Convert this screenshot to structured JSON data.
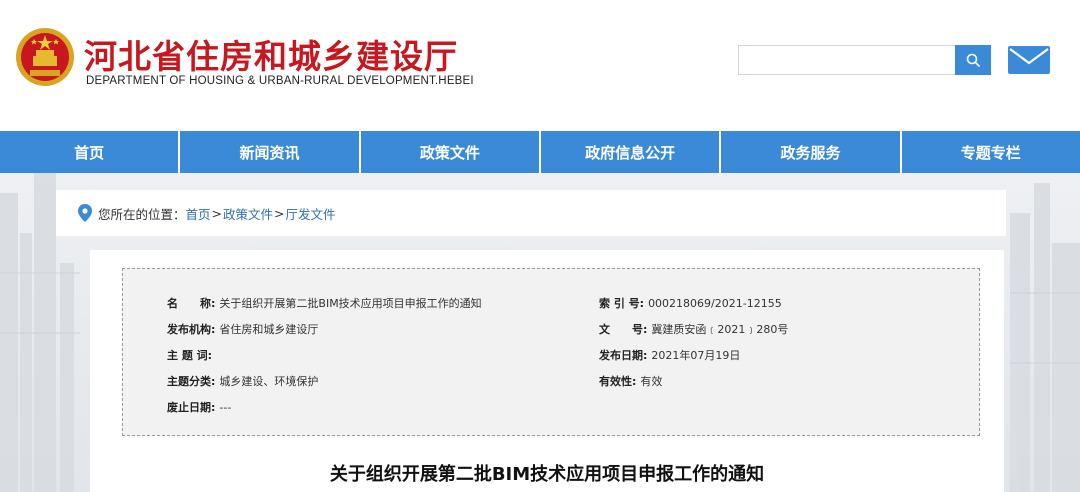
{
  "header": {
    "title": "河北省住房和城乡建设厅",
    "subtitle": "DEPARTMENT OF HOUSING & URBAN-RURAL DEVELOPMENT.HEBEI",
    "search": {
      "value": "",
      "placeholder": ""
    },
    "search_icon": "search-icon",
    "mail_icon": "mail-icon",
    "emblem_icon": "national-emblem-icon"
  },
  "nav": {
    "items": [
      {
        "label": "首页"
      },
      {
        "label": "新闻资讯"
      },
      {
        "label": "政策文件"
      },
      {
        "label": "政府信息公开"
      },
      {
        "label": "政务服务"
      },
      {
        "label": "专题专栏"
      }
    ]
  },
  "breadcrumb": {
    "label": "您所在的位置：",
    "items": [
      "首页",
      "政策文件",
      "厅发文件"
    ],
    "separator": ">"
  },
  "meta": {
    "name_key": "名　　称:",
    "name_val": "关于组织开展第二批BIM技术应用项目申报工作的通知",
    "issuer_key": "发布机构:",
    "issuer_val": "省住房和城乡建设厅",
    "keywords_key": "主 题 词:",
    "keywords_val": "",
    "category_key": "主题分类:",
    "category_val": "城乡建设、环境保护",
    "abolish_key": "废止日期:",
    "abolish_val": "---",
    "index_key": "索 引 号:",
    "index_val": "000218069/2021-12155",
    "docno_key": "文　　号:",
    "docno_val": "冀建质安函﹝2021﹞280号",
    "date_key": "发布日期:",
    "date_val": "2021年07月19日",
    "validity_key": "有效性:",
    "validity_val": "有效"
  },
  "document": {
    "title": "关于组织开展第二批BIM技术应用项目申报工作的通知"
  },
  "colors": {
    "brand_red": "#c8171e",
    "nav_blue": "#3a8ad8",
    "link_blue": "#2f6fb4"
  }
}
